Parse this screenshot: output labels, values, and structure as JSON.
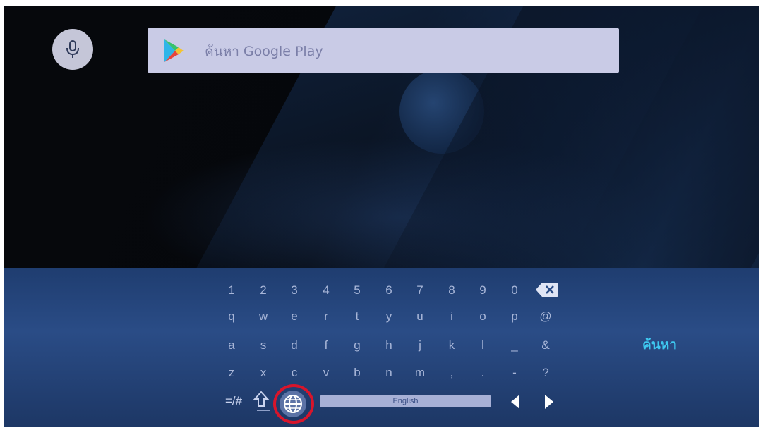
{
  "search": {
    "placeholder": "ค้นหา Google Play"
  },
  "keyboard": {
    "rows": [
      [
        "1",
        "2",
        "3",
        "4",
        "5",
        "6",
        "7",
        "8",
        "9",
        "0"
      ],
      [
        "q",
        "w",
        "e",
        "r",
        "t",
        "y",
        "u",
        "i",
        "o",
        "p",
        "@"
      ],
      [
        "a",
        "s",
        "d",
        "f",
        "g",
        "h",
        "j",
        "k",
        "l",
        "_",
        "&"
      ],
      [
        "z",
        "x",
        "c",
        "v",
        "b",
        "n",
        "m",
        ",",
        ".",
        "-",
        "?"
      ]
    ],
    "symbols_label": "=/#",
    "language_label": "English",
    "action_label": "ค้นหา"
  },
  "icons": {
    "mic": "mic-icon",
    "play": "google-play-icon",
    "backspace": "backspace-icon",
    "shift": "shift-icon",
    "language": "globe-icon",
    "left": "left-arrow-icon",
    "right": "right-arrow-icon"
  },
  "colors": {
    "accent": "#3ec8f0",
    "highlight_ring": "#d8152b",
    "keyboard_bg": "#2a4c86",
    "search_bg": "#c9cbe6"
  }
}
